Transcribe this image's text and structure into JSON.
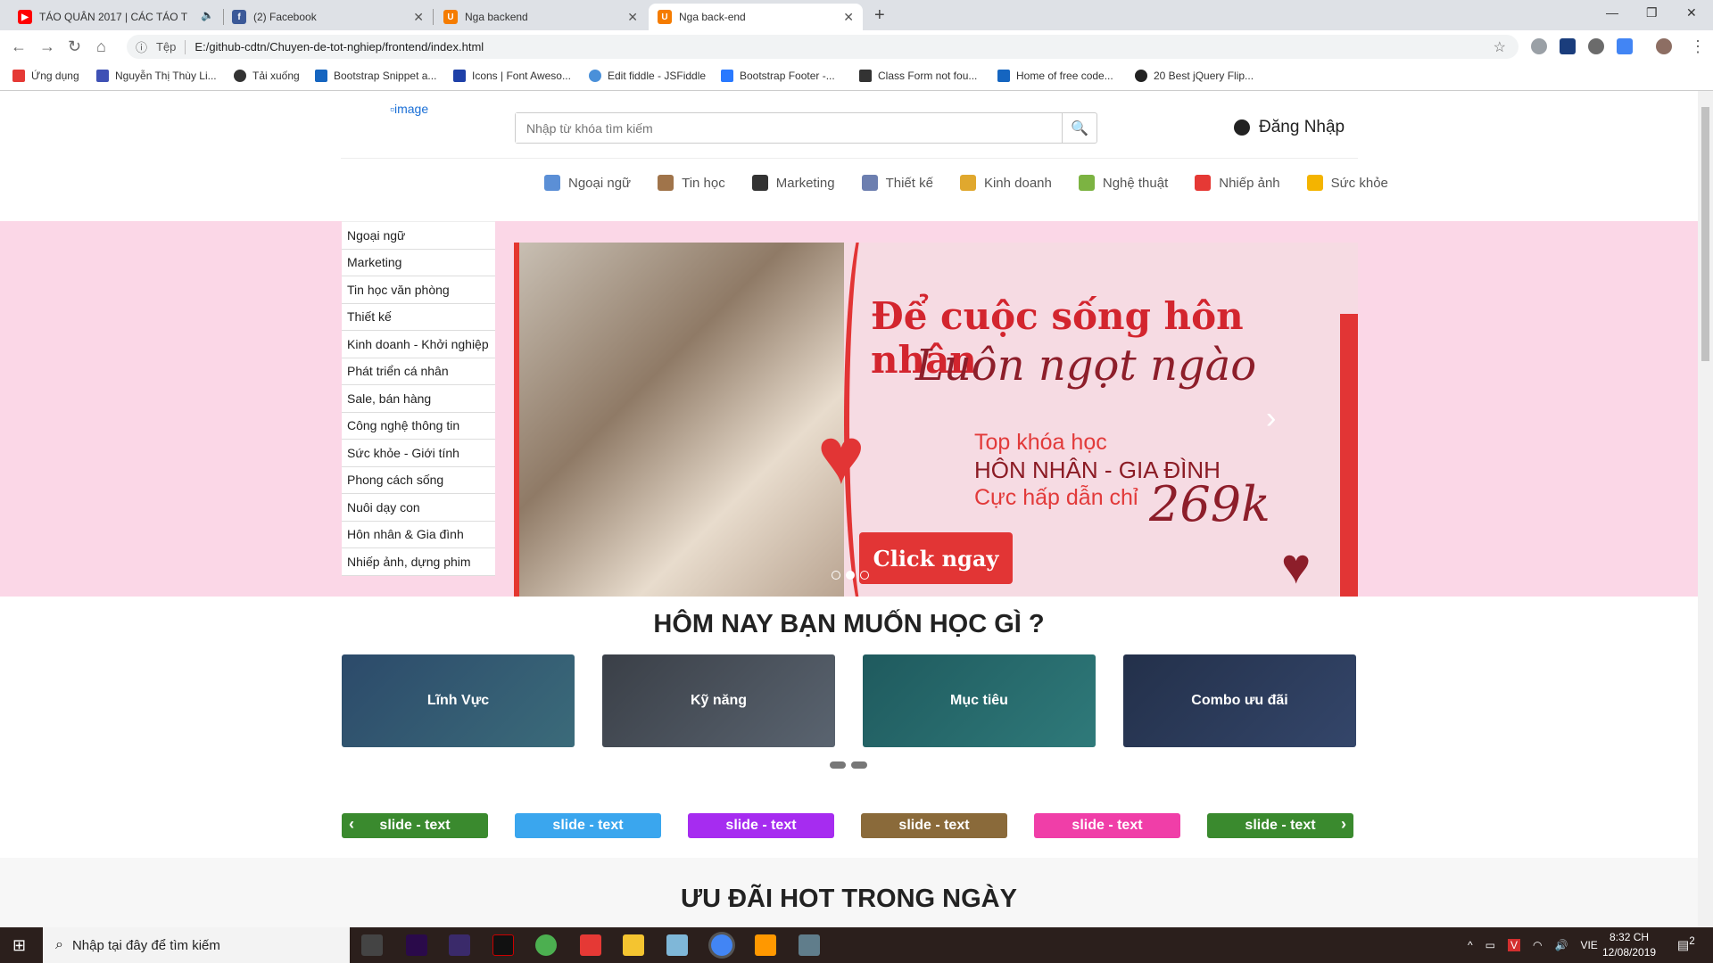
{
  "browser": {
    "tabs": [
      {
        "title": "TÁO QUÂN 2017 | CÁC TÁO T",
        "color": "#ff0000"
      },
      {
        "title": "(2) Facebook",
        "color": "#3b5998"
      },
      {
        "title": "Nga backend",
        "color": "#f57c00"
      },
      {
        "title": "Nga back-end",
        "color": "#f57c00"
      }
    ],
    "address_scheme": "Tệp",
    "address_url": "E:/github-cdtn/Chuyen-de-tot-nghiep/frontend/index.html",
    "bookmarks": [
      "Ứng dụng",
      "Nguyễn Thị Thùy Li...",
      "Tải xuống",
      "Bootstrap Snippet a...",
      "Icons | Font Aweso...",
      "Edit fiddle - JSFiddle",
      "Bootstrap Footer -...",
      "Class Form not fou...",
      "Home of free code...",
      "20 Best jQuery Flip..."
    ]
  },
  "header": {
    "logo_alt": "image",
    "search_placeholder": "Nhập từ khóa tìm kiếm",
    "login": "Đăng Nhập",
    "categories": [
      "Ngoại ngữ",
      "Tin học",
      "Marketing",
      "Thiết kế",
      "Kinh doanh",
      "Nghệ thuật",
      "Nhiếp ảnh",
      "Sức khỏe"
    ]
  },
  "side_menu": [
    "Ngoại ngữ",
    "Marketing",
    "Tin học văn phòng",
    "Thiết kế",
    "Kinh doanh - Khởi nghiệp",
    "Phát triển cá nhân",
    "Sale, bán hàng",
    "Công nghệ thông tin",
    "Sức khỏe - Giới tính",
    "Phong cách sống",
    "Nuôi dạy con",
    "Hôn nhân & Gia đình",
    "Nhiếp ảnh, dựng phim"
  ],
  "banner": {
    "line1": "Để cuộc sống hôn nhân",
    "line2": "Luôn ngọt ngào",
    "line3": "Top khóa học",
    "line4": "HÔN NHÂN - GIA ĐÌNH",
    "line5": "Cực hấp dẫn chỉ",
    "price": "269k",
    "button": "Click ngay"
  },
  "section1": {
    "title": "HÔM NAY BẠN MUỐN HỌC GÌ ?",
    "cards": [
      "Lĩnh Vực",
      "Kỹ năng",
      "Mục tiêu",
      "Combo ưu đãi"
    ]
  },
  "tags": [
    {
      "label": "slide - text",
      "color": "#3a8a2e"
    },
    {
      "label": "slide - text",
      "color": "#3aa6ee"
    },
    {
      "label": "slide - text",
      "color": "#a62cf0"
    },
    {
      "label": "slide - text",
      "color": "#8a6a3a"
    },
    {
      "label": "slide - text",
      "color": "#f03ea8"
    },
    {
      "label": "slide - text",
      "color": "#3a8a2e"
    }
  ],
  "section2": {
    "title": "ƯU ĐÃI HOT TRONG NGÀY"
  },
  "taskbar": {
    "search_placeholder": "Nhập tại đây để tìm kiếm",
    "lang": "VIE",
    "time": "8:32 CH",
    "date": "12/08/2019",
    "notif_count": "2"
  }
}
